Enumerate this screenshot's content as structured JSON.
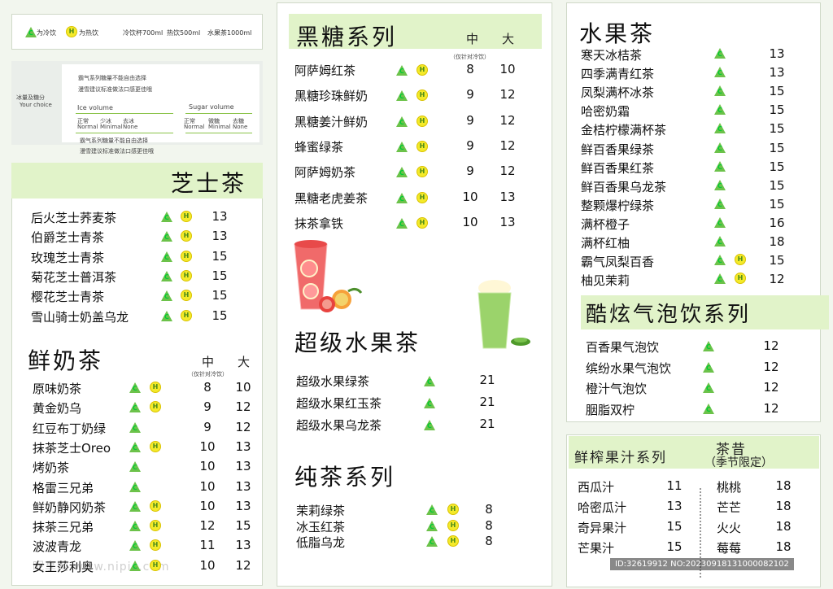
{
  "legend": {
    "cold_label": "为冷饮",
    "hot_label": "为热饮",
    "sizes": [
      "冷饮杯700ml",
      "热饮500ml",
      "水果茶1000ml"
    ]
  },
  "choice": {
    "title": "冰量及糖分",
    "title_en": "Your choice",
    "notes": [
      "霸气系列糖量不能自由选择",
      "漫雪建议标准做法口感更佳哦"
    ],
    "ice_label": "Ice volume",
    "sugar_label": "Sugar volume",
    "ice_opts": [
      [
        "正常",
        "Normal"
      ],
      [
        "少冰",
        "Minimal"
      ],
      [
        "去冰",
        "None"
      ]
    ],
    "sugar_opts": [
      [
        "正常",
        "Normal"
      ],
      [
        "微糖",
        "Minimal"
      ],
      [
        "去糖",
        "None"
      ]
    ]
  },
  "icons": {
    "cold": "C",
    "hot": "H"
  },
  "cheese": {
    "title": "芝士茶",
    "items": [
      {
        "name": "后火芝士荞麦茶",
        "price": "13"
      },
      {
        "name": "伯爵芝士青茶",
        "price": "13"
      },
      {
        "name": "玫瑰芝士青茶",
        "price": "15"
      },
      {
        "name": "菊花芝士普洱茶",
        "price": "15"
      },
      {
        "name": "樱花芝士青茶",
        "price": "15"
      },
      {
        "name": "雪山骑士奶盖乌龙",
        "price": "15"
      }
    ]
  },
  "milk": {
    "title": "鲜奶茶",
    "mid": "中",
    "large": "大",
    "note": "（仅针对冷饮）",
    "items": [
      {
        "name": "原味奶茶",
        "m": "8",
        "l": "10",
        "hot": true
      },
      {
        "name": "黄金奶乌",
        "m": "9",
        "l": "12",
        "hot": true
      },
      {
        "name": "红豆布丁奶绿",
        "m": "9",
        "l": "12",
        "hot": false
      },
      {
        "name": "抹茶芝士Oreo",
        "m": "10",
        "l": "13",
        "hot": true
      },
      {
        "name": "烤奶茶",
        "m": "10",
        "l": "13",
        "hot": false
      },
      {
        "name": "格雷三兄弟",
        "m": "10",
        "l": "13",
        "hot": false
      },
      {
        "name": "鲜奶静冈奶茶",
        "m": "10",
        "l": "13",
        "hot": true
      },
      {
        "name": "抹茶三兄弟",
        "m": "12",
        "l": "15",
        "hot": true
      },
      {
        "name": "波波青龙",
        "m": "11",
        "l": "13",
        "hot": true
      },
      {
        "name": "女王莎利奥",
        "m": "10",
        "l": "12",
        "hot": true
      }
    ]
  },
  "brown": {
    "title": "黑糖系列",
    "mid": "中",
    "large": "大",
    "note": "（仅针对冷饮）",
    "items": [
      {
        "name": "阿萨姆红茶",
        "m": "8",
        "l": "10"
      },
      {
        "name": "黑糖珍珠鲜奶",
        "m": "9",
        "l": "12"
      },
      {
        "name": "黑糖姜汁鲜奶",
        "m": "9",
        "l": "12"
      },
      {
        "name": "蜂蜜绿茶",
        "m": "9",
        "l": "12"
      },
      {
        "name": "阿萨姆奶茶",
        "m": "9",
        "l": "12"
      },
      {
        "name": "黑糖老虎姜茶",
        "m": "10",
        "l": "13"
      },
      {
        "name": "抹茶拿铁",
        "m": "10",
        "l": "13"
      }
    ]
  },
  "superfruit": {
    "title": "超级水果茶",
    "items": [
      {
        "name": "超级水果绿茶",
        "price": "21"
      },
      {
        "name": "超级水果红玉茶",
        "price": "21"
      },
      {
        "name": "超级水果乌龙茶",
        "price": "21"
      }
    ]
  },
  "puretea": {
    "title": "纯茶系列",
    "items": [
      {
        "name": "茉莉绿茶",
        "price": "8"
      },
      {
        "name": "冰玉红茶",
        "price": "8"
      },
      {
        "name": "低脂乌龙",
        "price": "8"
      }
    ]
  },
  "fruit": {
    "title": "水果茶",
    "items": [
      {
        "name": "寒天冰桔茶",
        "price": "13",
        "hot": false
      },
      {
        "name": "四季满青红茶",
        "price": "13",
        "hot": false
      },
      {
        "name": "凤梨满杯冰茶",
        "price": "15",
        "hot": false
      },
      {
        "name": "哈密奶霜",
        "price": "15",
        "hot": false
      },
      {
        "name": "金桔柠檬满杯茶",
        "price": "15",
        "hot": false
      },
      {
        "name": "鲜百香果绿茶",
        "price": "15",
        "hot": false
      },
      {
        "name": "鲜百香果红茶",
        "price": "15",
        "hot": false
      },
      {
        "name": "鲜百香果乌龙茶",
        "price": "15",
        "hot": false
      },
      {
        "name": "整颗爆柠绿茶",
        "price": "15",
        "hot": false
      },
      {
        "name": "满杯橙子",
        "price": "16",
        "hot": false
      },
      {
        "name": "满杯红柚",
        "price": "18",
        "hot": false
      },
      {
        "name": "霸气凤梨百香",
        "price": "15",
        "hot": true
      },
      {
        "name": "柚见茉莉",
        "price": "12",
        "hot": true
      }
    ]
  },
  "sparkling": {
    "title": "酷炫气泡饮系列",
    "items": [
      {
        "name": "百香果气泡饮",
        "price": "12"
      },
      {
        "name": "缤纷水果气泡饮",
        "price": "12"
      },
      {
        "name": "橙汁气泡饮",
        "price": "12"
      },
      {
        "name": "胭脂双柠",
        "price": "12"
      }
    ]
  },
  "juice": {
    "title": "鲜榨果汁系列",
    "items": [
      {
        "name": "西瓜汁",
        "price": "11"
      },
      {
        "name": "哈密瓜汁",
        "price": "13"
      },
      {
        "name": "奇异果汁",
        "price": "15"
      },
      {
        "name": "芒果汁",
        "price": "15"
      }
    ]
  },
  "seasonal": {
    "title": "茶昔",
    "subtitle": "（季节限定）",
    "items": [
      {
        "name": "桃桃",
        "price": "18"
      },
      {
        "name": "芒芒",
        "price": "18"
      },
      {
        "name": "火火",
        "price": "18"
      },
      {
        "name": "莓莓",
        "price": "18"
      }
    ]
  },
  "watermark": {
    "logo": "昵享网 www.nipic.com",
    "id": "ID:32619912 NO:20230918131000082102"
  }
}
